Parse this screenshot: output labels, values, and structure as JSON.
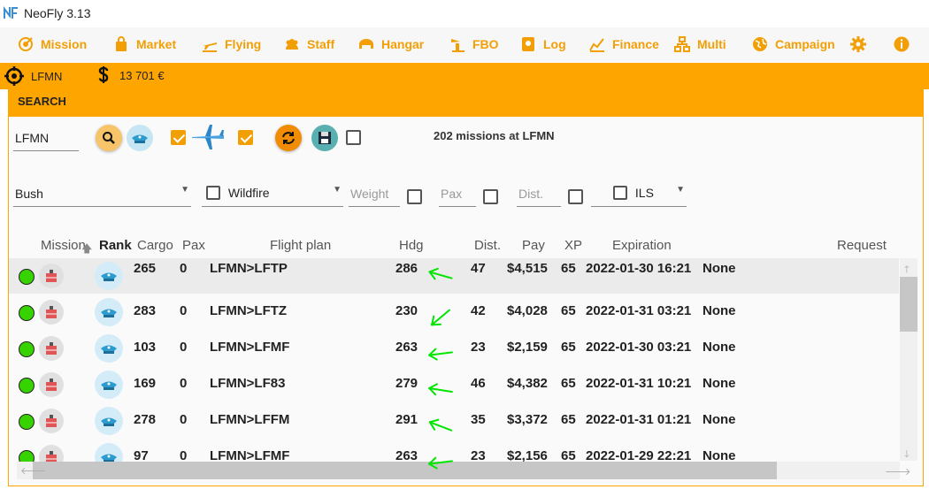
{
  "app": {
    "title": "NeoFly 3.13"
  },
  "nav": [
    {
      "label": "Mission",
      "icon": "target-icon"
    },
    {
      "label": "Market",
      "icon": "bag-icon"
    },
    {
      "label": "Flying",
      "icon": "plane-icon"
    },
    {
      "label": "Staff",
      "icon": "people-icon"
    },
    {
      "label": "Hangar",
      "icon": "hangar-icon"
    },
    {
      "label": "FBO",
      "icon": "tower-icon"
    },
    {
      "label": "Log",
      "icon": "log-icon"
    },
    {
      "label": "Finance",
      "icon": "finance-icon"
    },
    {
      "label": "Multi",
      "icon": "network-icon"
    },
    {
      "label": "Campaign",
      "icon": "globe-icon"
    }
  ],
  "status": {
    "location": "LFMN",
    "money": "13 701 €"
  },
  "search": {
    "header": "SEARCH",
    "airport_value": "LFMN",
    "missions_count_text": "202 missions at  LFMN",
    "type_value": "Bush",
    "wildfire_label": "Wildfire",
    "weight_placeholder": "Weight",
    "pax_placeholder": "Pax",
    "dist_placeholder": "Dist.",
    "ils_label": "ILS"
  },
  "table": {
    "headers": {
      "mission": "Mission",
      "rank": "Rank",
      "cargo": "Cargo",
      "pax": "Pax",
      "flight_plan": "Flight plan",
      "hdg": "Hdg",
      "dist": "Dist.",
      "pay": "Pay",
      "xp": "XP",
      "expiration": "Expiration",
      "request": "Request"
    },
    "rows": [
      {
        "cargo": "265",
        "pax": "0",
        "plan": "LFMN>LFTP",
        "hdg": "286",
        "dist": "47",
        "pay": "$4,515",
        "xp": "65",
        "exp": "2022-01-30 16:21",
        "req": "None"
      },
      {
        "cargo": "283",
        "pax": "0",
        "plan": "LFMN>LFTZ",
        "hdg": "230",
        "dist": "42",
        "pay": "$4,028",
        "xp": "65",
        "exp": "2022-01-31 03:21",
        "req": "None"
      },
      {
        "cargo": "103",
        "pax": "0",
        "plan": "LFMN>LFMF",
        "hdg": "263",
        "dist": "23",
        "pay": "$2,159",
        "xp": "65",
        "exp": "2022-01-30 03:21",
        "req": "None"
      },
      {
        "cargo": "169",
        "pax": "0",
        "plan": "LFMN>LF83",
        "hdg": "279",
        "dist": "46",
        "pay": "$4,382",
        "xp": "65",
        "exp": "2022-01-31 10:21",
        "req": "None"
      },
      {
        "cargo": "278",
        "pax": "0",
        "plan": "LFMN>LFFM",
        "hdg": "291",
        "dist": "35",
        "pay": "$3,372",
        "xp": "65",
        "exp": "2022-01-31 01:21",
        "req": "None"
      },
      {
        "cargo": "97",
        "pax": "0",
        "plan": "LFMN>LFMF",
        "hdg": "263",
        "dist": "23",
        "pay": "$2,156",
        "xp": "65",
        "exp": "2022-01-29 22:21",
        "req": "None"
      }
    ]
  },
  "colors": {
    "accent": "#ffa500",
    "nav_text": "#f29f05",
    "status_dot": "#36d300",
    "arrow": "#00e600"
  }
}
